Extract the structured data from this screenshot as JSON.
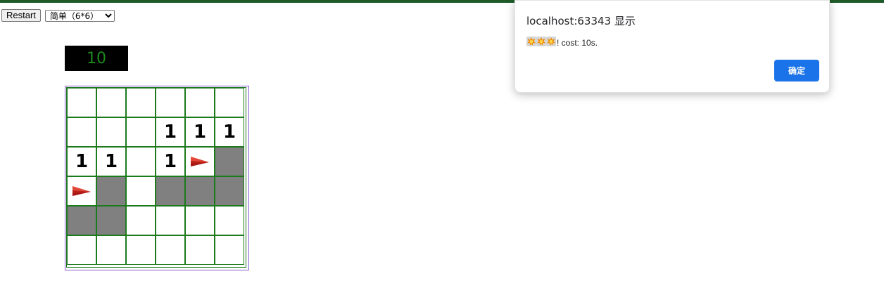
{
  "controls": {
    "restart_label": "Restart",
    "difficulty_selected": "简单（6*6）"
  },
  "timer": {
    "value": "10"
  },
  "board": {
    "rows": 6,
    "cols": 6,
    "cells": [
      [
        "",
        "",
        "",
        "",
        "",
        ""
      ],
      [
        "",
        "",
        "",
        "1",
        "1",
        "1"
      ],
      [
        "1",
        "1",
        "",
        "1",
        "flag",
        "hidden"
      ],
      [
        "flag",
        "hidden",
        "",
        "hidden",
        "hidden",
        "hidden"
      ],
      [
        "hidden",
        "hidden",
        "",
        "",
        "",
        ""
      ],
      [
        "",
        "",
        "",
        "",
        "",
        ""
      ]
    ]
  },
  "dialog": {
    "title": "localhost:63343 显示",
    "message_suffix": "! cost: 10s.",
    "icons": [
      "explosion-icon",
      "explosion-icon",
      "explosion-icon"
    ],
    "ok_label": "确定"
  },
  "colors": {
    "top_bar": "#1f5a2a",
    "timer_text": "#1c8a1c",
    "grid_line": "#1c7a1c",
    "hidden_cell": "#808080",
    "ok_button": "#1a73e8"
  }
}
